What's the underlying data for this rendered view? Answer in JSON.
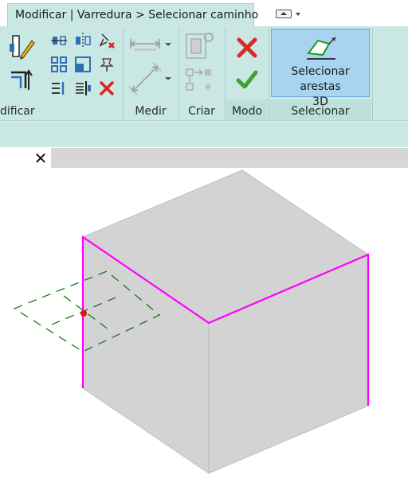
{
  "context_tab": {
    "label": "Modificar | Varredura > Selecionar caminho"
  },
  "panels": {
    "modify_label": "dificar",
    "measure_label": "Medir",
    "create_label": "Criar",
    "mode_label": "Modo",
    "select_label": "Selecionar"
  },
  "select_3d_edges": {
    "label_line1": "Selecionar arestas",
    "label_line2": "3D"
  },
  "icons": {
    "quick_access": "collapse-ribbon-icon",
    "cancel": "red-x-icon",
    "finish": "green-check-icon",
    "close_view": "close-icon"
  },
  "colors": {
    "ribbon_bg": "#c9e8e4",
    "selected_edge": "#ff00ff",
    "cube_face": "#d3d3d3",
    "reference_plane": "#0a6e0a",
    "work_point": "#e81010"
  },
  "view": {
    "close_label": "✕"
  }
}
